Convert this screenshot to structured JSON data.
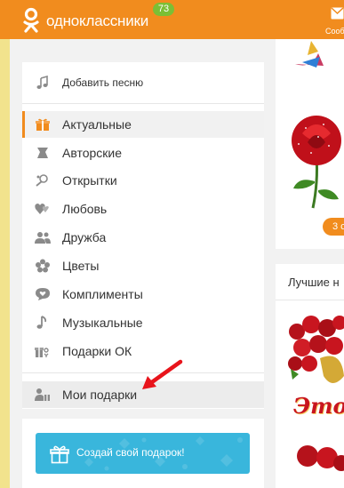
{
  "header": {
    "logo_text": "одноклассники",
    "badge_count": "73",
    "messages_label": "Сооб"
  },
  "menu": {
    "top_item": {
      "label": "Добавить песню",
      "icon": "music-note-icon"
    },
    "categories": [
      {
        "label": "Актуальные",
        "icon": "gift-icon",
        "state": "active"
      },
      {
        "label": "Авторские",
        "icon": "author-icon"
      },
      {
        "label": "Открытки",
        "icon": "postcard-icon"
      },
      {
        "label": "Любовь",
        "icon": "hearts-icon"
      },
      {
        "label": "Дружба",
        "icon": "friends-icon"
      },
      {
        "label": "Цветы",
        "icon": "flower-icon"
      },
      {
        "label": "Комплименты",
        "icon": "speech-heart-icon"
      },
      {
        "label": "Музыкальные",
        "icon": "music-note-icon"
      },
      {
        "label": "Подарки ОК",
        "icon": "ok-gift-icon"
      }
    ],
    "my_gifts": {
      "label": "Мои подарки",
      "icon": "user-gift-icon"
    },
    "create_button": {
      "label": "Создай свой подарок!",
      "icon": "gift-icon"
    }
  },
  "right_panel": {
    "count_label": "3 с",
    "best_title": "Лучшие н",
    "card_text": "Это"
  },
  "colors": {
    "brand_orange": "#f18c1e",
    "badge_green": "#7bbf35",
    "button_blue": "#39b6dc",
    "arrow_red": "#e8141b"
  }
}
